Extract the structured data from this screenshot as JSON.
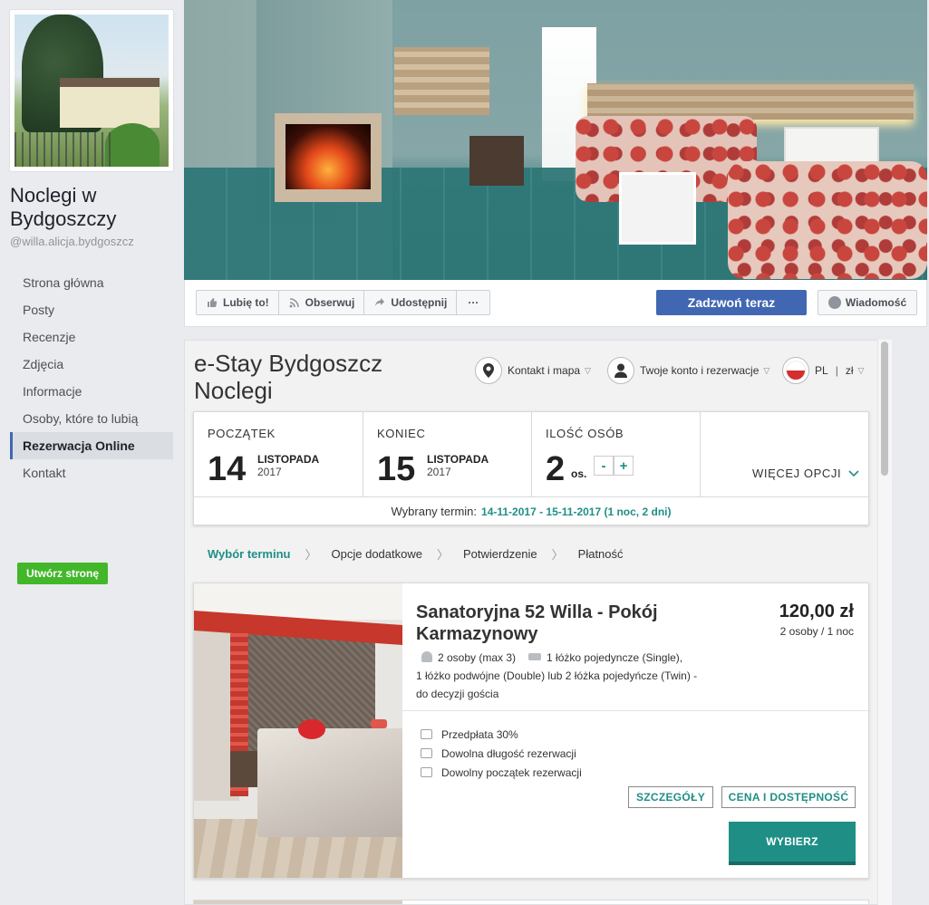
{
  "fb_page": {
    "name": "Noclegi w Bydgoszczy",
    "handle": "@willa.alicja.bydgoszcz",
    "nav": [
      {
        "label": "Strona główna"
      },
      {
        "label": "Posty"
      },
      {
        "label": "Recenzje"
      },
      {
        "label": "Zdjęcia"
      },
      {
        "label": "Informacje"
      },
      {
        "label": "Osoby, które to lubią"
      },
      {
        "label": "Rezerwacja Online",
        "active": true
      },
      {
        "label": "Kontakt"
      }
    ],
    "create_page": "Utwórz stronę"
  },
  "actions": {
    "like": "Lubię to!",
    "follow": "Obserwuj",
    "share": "Udostępnij",
    "more": "···",
    "call": "Zadzwoń teraz",
    "message": "Wiadomość"
  },
  "booking": {
    "title": "e-Stay Bydgoszcz Noclegi",
    "links": {
      "contact": "Kontakt i mapa",
      "account": "Twoje konto i rezerwacje",
      "language": "PL",
      "currency_sep": "|",
      "currency": "zł"
    },
    "start": {
      "label": "POCZĄTEK",
      "day": "14",
      "month": "LISTOPADA",
      "year": "2017"
    },
    "end": {
      "label": "KONIEC",
      "day": "15",
      "month": "LISTOPADA",
      "year": "2017"
    },
    "guests": {
      "label": "ILOŚĆ OSÓB",
      "count": "2",
      "unit": "os.",
      "minus": "-",
      "plus": "+"
    },
    "more_options": "WIĘCEJ OPCJI",
    "selected_label": "Wybrany termin:",
    "selected_range": "14-11-2017 - 15-11-2017 (1 noc, 2 dni)",
    "steps": [
      {
        "label": "Wybór terminu",
        "active": true
      },
      {
        "label": "Opcje dodatkowe"
      },
      {
        "label": "Potwierdzenie"
      },
      {
        "label": "Płatność"
      }
    ],
    "room": {
      "name": "Sanatoryjna 52 Willa - Pokój Karmazynowy",
      "price": "120,00 zł",
      "price_sub": "2 osoby / 1 noc",
      "capacity": "2 osoby (max 3)",
      "beds_line1": "1 łóżko pojedyncze (Single),",
      "beds_line2": "1 łóżko podwójne (Double) lub 2 łóżka pojedyńcze (Twin) -",
      "beds_line3": "do decyzji gościa",
      "features": [
        "Przedpłata 30%",
        "Dowolna długość rezerwacji",
        "Dowolny początek rezerwacji"
      ],
      "details_btn": "SZCZEGÓŁY",
      "price_btn": "CENA I DOSTĘPNOŚĆ",
      "choose_btn": "WYBIERZ"
    }
  },
  "colors": {
    "fb_blue": "#4267b2",
    "fb_green": "#42b72a",
    "teal": "#1f8f86"
  }
}
